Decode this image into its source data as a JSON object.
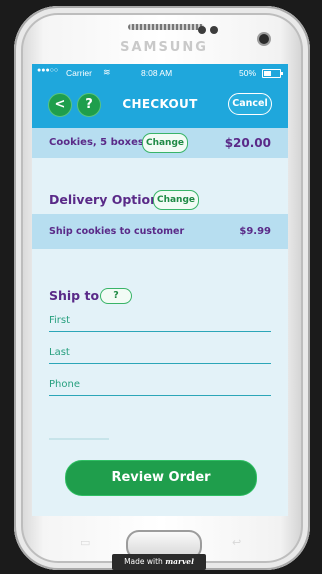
{
  "device": {
    "brand": "SAMSUNG"
  },
  "status_bar": {
    "signal": "●●●○○",
    "carrier": "Carrier",
    "time": "8:08 AM",
    "battery": "50%"
  },
  "header": {
    "back_label": "<",
    "help_label": "?",
    "title": "CHECKOUT",
    "cancel_label": "Cancel"
  },
  "order_item": {
    "label": "Cookies, 5 boxes",
    "change_label": "Change",
    "price": "$20.00"
  },
  "delivery": {
    "title": "Delivery Option",
    "change_label": "Change",
    "option_label": "Ship cookies to customer",
    "option_price": "$9.99"
  },
  "ship_to": {
    "title": "Ship to",
    "help_label": "?",
    "fields": {
      "first_placeholder": "First",
      "last_placeholder": "Last",
      "phone_placeholder": "Phone"
    }
  },
  "review_button": "Review Order",
  "badge": {
    "prefix": "Made with",
    "brand": "marvel"
  },
  "colors": {
    "header_blue": "#1fa7dc",
    "accent_green": "#1f9e4c",
    "heading_purple": "#5a2a88",
    "band_blue": "#b7def0"
  }
}
